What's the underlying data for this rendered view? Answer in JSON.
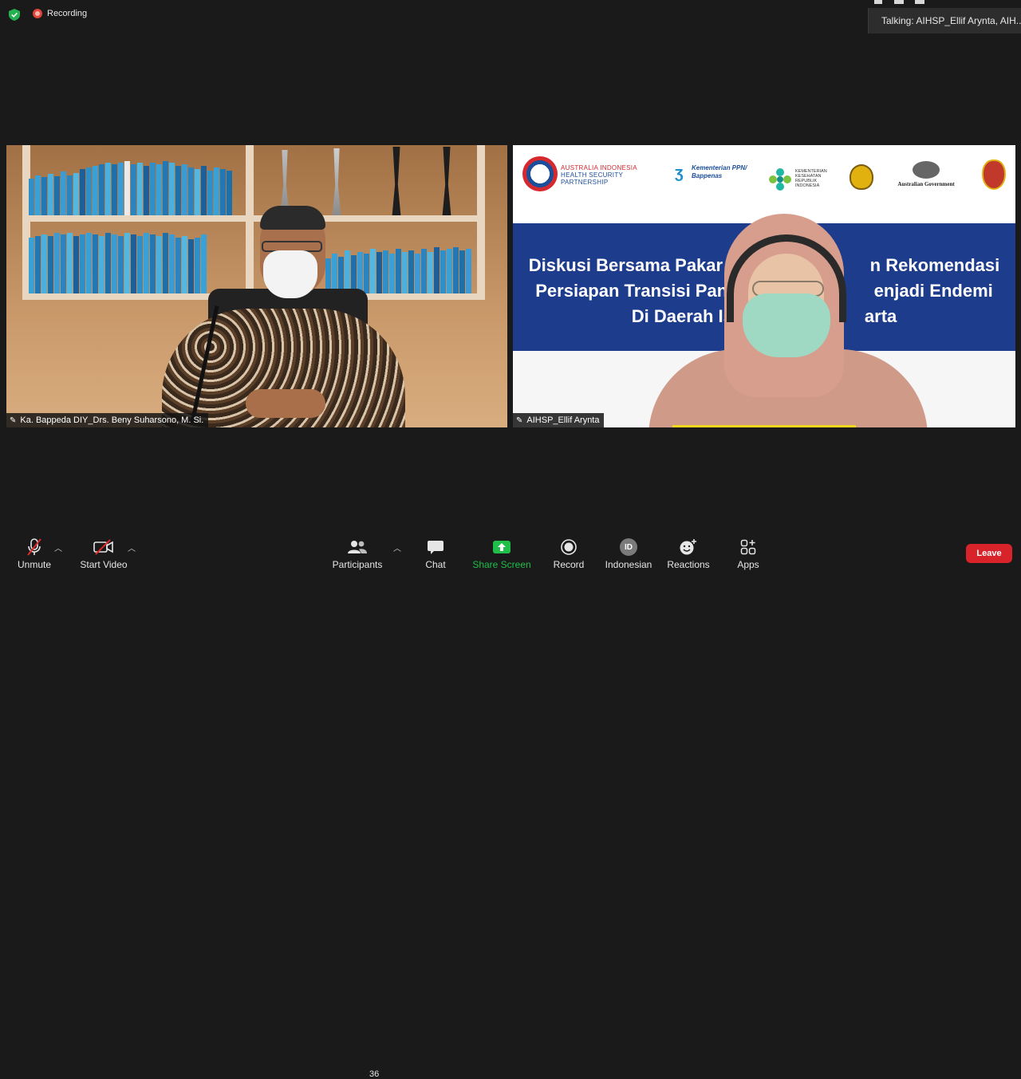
{
  "recording": {
    "label": "Recording"
  },
  "talking": {
    "text": "Talking:  AIHSP_Ellif  Arynta,  AIH..."
  },
  "participants": {
    "left": {
      "name": "Ka. Bappeda DIY_Drs. Beny Suharsono, M. Si."
    },
    "right": {
      "name": "AIHSP_Ellif Arynta"
    }
  },
  "slide": {
    "partnership_name": [
      "AUSTRALIA INDONESIA",
      "HEALTH SECURITY",
      "PARTNERSHIP"
    ],
    "ppn_label": [
      "Kementerian PPN/",
      "Bappenas"
    ],
    "kemkes_label": [
      "KEMENTERIAN",
      "KESEHATAN",
      "REPUBLIK",
      "INDONESIA"
    ],
    "ausgov_label": "Australian Government",
    "title_lines": [
      "Diskusi Bersama Pakar u",
      "n Rekomendasi",
      "Persiapan Transisi Pand",
      "enjadi Endemi",
      "Di Daerah Is",
      "arta"
    ]
  },
  "toolbar": {
    "unmute": "Unmute",
    "start_video": "Start Video",
    "participants": "Participants",
    "participant_count": "36",
    "chat": "Chat",
    "share_screen": "Share Screen",
    "record": "Record",
    "language": "Indonesian",
    "language_badge": "ID",
    "reactions": "Reactions",
    "apps": "Apps",
    "leave": "Leave"
  },
  "colors": {
    "share_green": "#1fbf4a",
    "leave_red": "#d8232a",
    "slide_blue": "#1d3c8c",
    "speaker_highlight": "#f2d51e"
  }
}
